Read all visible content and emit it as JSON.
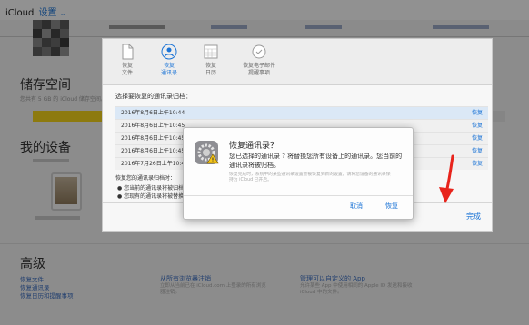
{
  "header": {
    "brand": "iCloud",
    "service": "设置",
    "caret": "⌄"
  },
  "storage": {
    "title": "储存空间",
    "note": "您共有 5 GB 的 iCloud 储存空间。"
  },
  "devices": {
    "title": "我的设备"
  },
  "advanced": {
    "title": "高级",
    "links": [
      "恢复文件",
      "恢复通讯录",
      "恢复日历和提醒事项"
    ],
    "col2_title": "从所有浏览器注销",
    "col2_text": "立即从当前已在 iCloud.com 上登录的所有浏览器注销。",
    "col3_title": "管理可以自定义的 App",
    "col3_text": "允许某些 App 中使用相同的 Apple ID 发送和接收 iCloud 中的文件。"
  },
  "panel": {
    "tabs": [
      {
        "label": "恢复\n文件",
        "icon": "document-icon"
      },
      {
        "label": "恢复\n通讯录",
        "icon": "contacts-icon",
        "active": true
      },
      {
        "label": "恢复\n日历",
        "icon": "calendar-icon"
      },
      {
        "label": "恢复电子邮件\n提醒事项",
        "icon": "reminders-icon"
      }
    ],
    "heading": "选择要恢复的通讯录归档：",
    "rows": [
      {
        "date": "2016年8月6日上午10:44",
        "action": "恢复"
      },
      {
        "date": "2016年8月6日上午10:45",
        "action": "恢复"
      },
      {
        "date": "2016年8月6日上午10:45",
        "action": "恢复"
      },
      {
        "date": "2016年8月6日上午10:45",
        "action": "恢复"
      },
      {
        "date": "2016年7月26日上午10:45",
        "action": "恢复"
      }
    ],
    "info_heading": "恢复您的通讯录归档时：",
    "bullets": [
      "您当前的通讯录将被归档",
      "您现有的通讯录将被替换"
    ],
    "done_label": "完成"
  },
  "alert": {
    "title": "恢复通讯录？",
    "message": "您已选择的通讯录 ? 将替换您所有设备上的通讯录。您当前的通讯录将被归档。",
    "note": "恢复完成时，系统中的某些通讯录设置会被恢复到新的设置。请将您设备的通讯录保持为 iCloud 已开启。",
    "cancel_label": "取消",
    "restore_label": "恢复"
  },
  "colors": {
    "accent": "#1a73d6",
    "storage_bar": "#f3d21a",
    "arrow": "#e8241c"
  }
}
